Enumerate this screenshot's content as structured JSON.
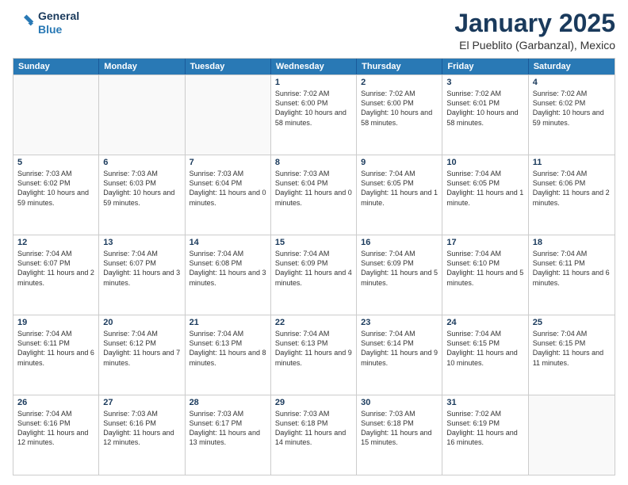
{
  "logo": {
    "line1": "General",
    "line2": "Blue"
  },
  "title": "January 2025",
  "location": "El Pueblito (Garbanzal), Mexico",
  "days_header": [
    "Sunday",
    "Monday",
    "Tuesday",
    "Wednesday",
    "Thursday",
    "Friday",
    "Saturday"
  ],
  "weeks": [
    [
      {
        "day": "",
        "info": ""
      },
      {
        "day": "",
        "info": ""
      },
      {
        "day": "",
        "info": ""
      },
      {
        "day": "1",
        "info": "Sunrise: 7:02 AM\nSunset: 6:00 PM\nDaylight: 10 hours and 58 minutes."
      },
      {
        "day": "2",
        "info": "Sunrise: 7:02 AM\nSunset: 6:00 PM\nDaylight: 10 hours and 58 minutes."
      },
      {
        "day": "3",
        "info": "Sunrise: 7:02 AM\nSunset: 6:01 PM\nDaylight: 10 hours and 58 minutes."
      },
      {
        "day": "4",
        "info": "Sunrise: 7:02 AM\nSunset: 6:02 PM\nDaylight: 10 hours and 59 minutes."
      }
    ],
    [
      {
        "day": "5",
        "info": "Sunrise: 7:03 AM\nSunset: 6:02 PM\nDaylight: 10 hours and 59 minutes."
      },
      {
        "day": "6",
        "info": "Sunrise: 7:03 AM\nSunset: 6:03 PM\nDaylight: 10 hours and 59 minutes."
      },
      {
        "day": "7",
        "info": "Sunrise: 7:03 AM\nSunset: 6:04 PM\nDaylight: 11 hours and 0 minutes."
      },
      {
        "day": "8",
        "info": "Sunrise: 7:03 AM\nSunset: 6:04 PM\nDaylight: 11 hours and 0 minutes."
      },
      {
        "day": "9",
        "info": "Sunrise: 7:04 AM\nSunset: 6:05 PM\nDaylight: 11 hours and 1 minute."
      },
      {
        "day": "10",
        "info": "Sunrise: 7:04 AM\nSunset: 6:05 PM\nDaylight: 11 hours and 1 minute."
      },
      {
        "day": "11",
        "info": "Sunrise: 7:04 AM\nSunset: 6:06 PM\nDaylight: 11 hours and 2 minutes."
      }
    ],
    [
      {
        "day": "12",
        "info": "Sunrise: 7:04 AM\nSunset: 6:07 PM\nDaylight: 11 hours and 2 minutes."
      },
      {
        "day": "13",
        "info": "Sunrise: 7:04 AM\nSunset: 6:07 PM\nDaylight: 11 hours and 3 minutes."
      },
      {
        "day": "14",
        "info": "Sunrise: 7:04 AM\nSunset: 6:08 PM\nDaylight: 11 hours and 3 minutes."
      },
      {
        "day": "15",
        "info": "Sunrise: 7:04 AM\nSunset: 6:09 PM\nDaylight: 11 hours and 4 minutes."
      },
      {
        "day": "16",
        "info": "Sunrise: 7:04 AM\nSunset: 6:09 PM\nDaylight: 11 hours and 5 minutes."
      },
      {
        "day": "17",
        "info": "Sunrise: 7:04 AM\nSunset: 6:10 PM\nDaylight: 11 hours and 5 minutes."
      },
      {
        "day": "18",
        "info": "Sunrise: 7:04 AM\nSunset: 6:11 PM\nDaylight: 11 hours and 6 minutes."
      }
    ],
    [
      {
        "day": "19",
        "info": "Sunrise: 7:04 AM\nSunset: 6:11 PM\nDaylight: 11 hours and 6 minutes."
      },
      {
        "day": "20",
        "info": "Sunrise: 7:04 AM\nSunset: 6:12 PM\nDaylight: 11 hours and 7 minutes."
      },
      {
        "day": "21",
        "info": "Sunrise: 7:04 AM\nSunset: 6:13 PM\nDaylight: 11 hours and 8 minutes."
      },
      {
        "day": "22",
        "info": "Sunrise: 7:04 AM\nSunset: 6:13 PM\nDaylight: 11 hours and 9 minutes."
      },
      {
        "day": "23",
        "info": "Sunrise: 7:04 AM\nSunset: 6:14 PM\nDaylight: 11 hours and 9 minutes."
      },
      {
        "day": "24",
        "info": "Sunrise: 7:04 AM\nSunset: 6:15 PM\nDaylight: 11 hours and 10 minutes."
      },
      {
        "day": "25",
        "info": "Sunrise: 7:04 AM\nSunset: 6:15 PM\nDaylight: 11 hours and 11 minutes."
      }
    ],
    [
      {
        "day": "26",
        "info": "Sunrise: 7:04 AM\nSunset: 6:16 PM\nDaylight: 11 hours and 12 minutes."
      },
      {
        "day": "27",
        "info": "Sunrise: 7:03 AM\nSunset: 6:16 PM\nDaylight: 11 hours and 12 minutes."
      },
      {
        "day": "28",
        "info": "Sunrise: 7:03 AM\nSunset: 6:17 PM\nDaylight: 11 hours and 13 minutes."
      },
      {
        "day": "29",
        "info": "Sunrise: 7:03 AM\nSunset: 6:18 PM\nDaylight: 11 hours and 14 minutes."
      },
      {
        "day": "30",
        "info": "Sunrise: 7:03 AM\nSunset: 6:18 PM\nDaylight: 11 hours and 15 minutes."
      },
      {
        "day": "31",
        "info": "Sunrise: 7:02 AM\nSunset: 6:19 PM\nDaylight: 11 hours and 16 minutes."
      },
      {
        "day": "",
        "info": ""
      }
    ]
  ]
}
